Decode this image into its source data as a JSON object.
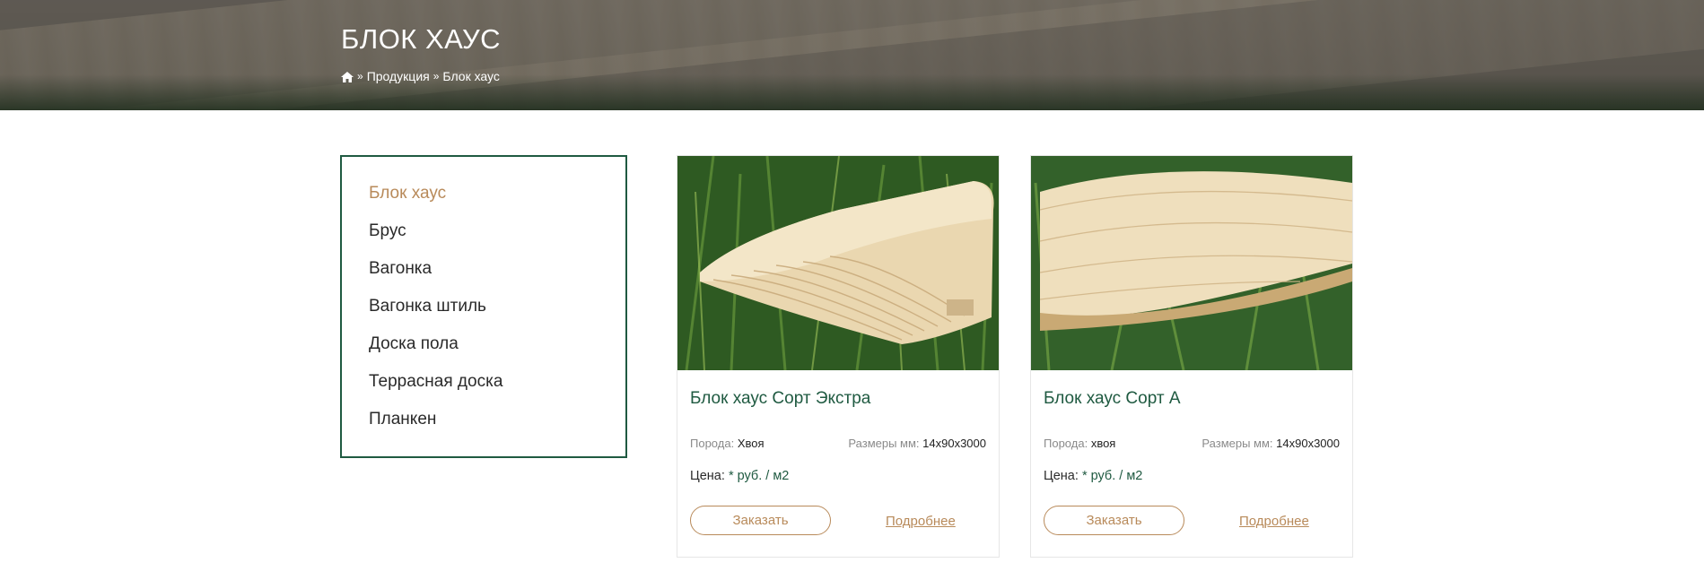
{
  "hero": {
    "title": "БЛОК ХАУС",
    "breadcrumb": {
      "items": [
        "Продукция",
        "Блок хаус"
      ],
      "separator": "»"
    }
  },
  "sidebar": {
    "items": [
      {
        "label": "Блок хаус",
        "active": true
      },
      {
        "label": "Брус",
        "active": false
      },
      {
        "label": "Вагонка",
        "active": false
      },
      {
        "label": "Вагонка штиль",
        "active": false
      },
      {
        "label": "Доска пола",
        "active": false
      },
      {
        "label": "Террасная доска",
        "active": false
      },
      {
        "label": "Планкен",
        "active": false
      }
    ]
  },
  "products": [
    {
      "name": "Блок хаус Сорт Экстра",
      "species_label": "Порода:",
      "species": "Хвоя",
      "size_label": "Размеры мм:",
      "size": "14x90x3000",
      "price_label": "Цена:",
      "price": "* руб. / м2",
      "order_label": "Заказать",
      "more_label": "Подробнее"
    },
    {
      "name": "Блок хаус Сорт А",
      "species_label": "Порода:",
      "species": "хвоя",
      "size_label": "Размеры мм:",
      "size": "14x90x3000",
      "price_label": "Цена:",
      "price": "* руб. / м2",
      "order_label": "Заказать",
      "more_label": "Подробнее"
    }
  ],
  "colors": {
    "accent_green": "#1f5a41",
    "accent_brown": "#b88a5a"
  },
  "icons": {
    "home": "home-icon"
  }
}
